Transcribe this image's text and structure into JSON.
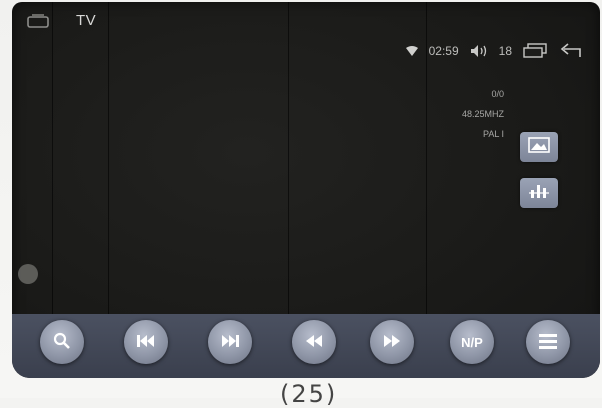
{
  "header": {
    "title": "TV",
    "time": "02:59",
    "volume": "18"
  },
  "info": {
    "channel": "0/0",
    "frequency": "48.25MHZ",
    "standard": "PAL I"
  },
  "controls": {
    "np_label": "N/P"
  },
  "caption": "(25)",
  "icons": {
    "home": "home-icon",
    "wifi": "wifi-icon",
    "volume": "volume-icon",
    "windows": "windows-icon",
    "back": "back-icon",
    "picture": "picture-icon",
    "equalizer": "equalizer-icon",
    "search": "search-icon",
    "prev": "prev-track-icon",
    "next": "next-track-icon",
    "rewind": "rewind-icon",
    "forward": "fast-forward-icon",
    "list": "list-icon"
  },
  "colors": {
    "screen": "#1a1a18",
    "controlbar": "#3f4553",
    "button": "#9aa1b2"
  }
}
